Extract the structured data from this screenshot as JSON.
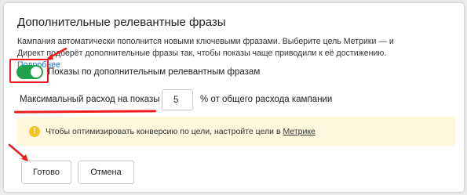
{
  "panel": {
    "title": "Дополнительные релевантные фразы",
    "description": "Кампания автоматически пополнится новыми ключевыми фразами. Выберите цель Метрики — и Директ подберёт дополнительные фразы так, чтобы показы чаще приводили к её достижению.",
    "more_link": "Подробнее"
  },
  "toggle": {
    "label": "Показы по дополнительным релевантным фразам",
    "on": true
  },
  "max_spend": {
    "label": "Максимальный расход на показы",
    "value": "5",
    "suffix": "% от общего расхода кампании"
  },
  "notice": {
    "icon": "warning-icon",
    "text": "Чтобы оптимизировать конверсию по цели, настройте цели в",
    "link": "Метрике"
  },
  "buttons": {
    "done": "Готово",
    "cancel": "Отмена"
  },
  "colors": {
    "accent_green": "#20a34a",
    "annotation_red": "#ee1c1c",
    "link_blue": "#1a73d9",
    "notice_bg": "#fff8dd"
  }
}
